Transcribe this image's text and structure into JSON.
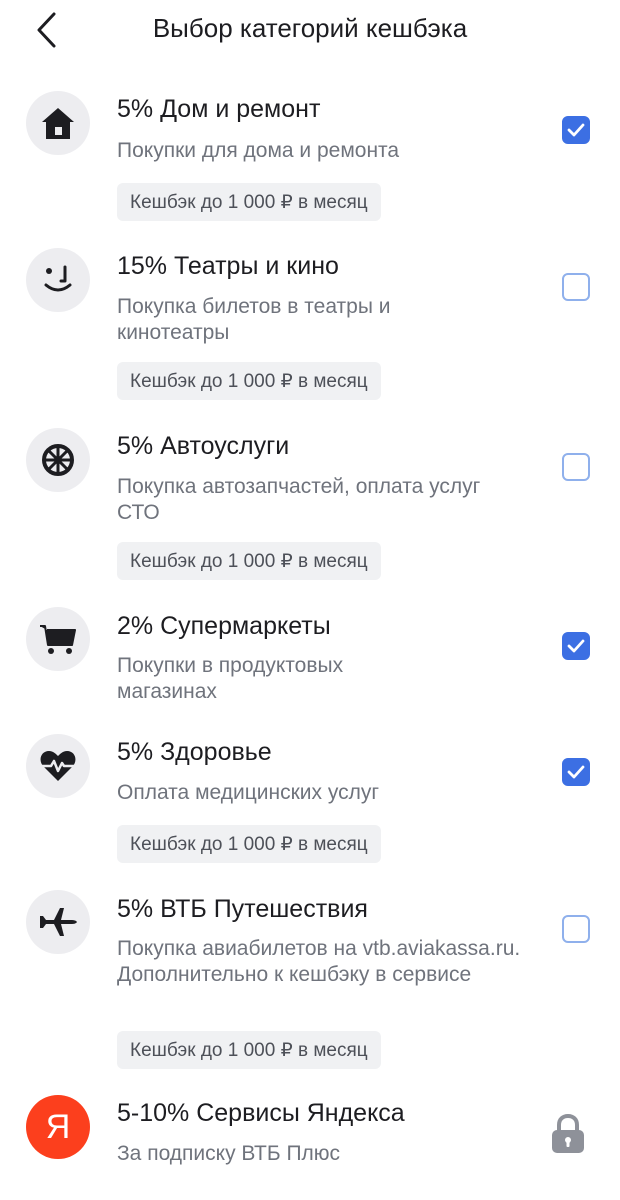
{
  "header": {
    "title": "Выбор категорий кешбэка"
  },
  "items": [
    {
      "title": "5% Дом и ремонт",
      "desc": "Покупки для дома и ремонта",
      "chip": "Кешбэк до 1 000 ₽ в месяц",
      "icon": "house-icon",
      "checked": true
    },
    {
      "title": "15% Театры и кино",
      "desc": "Покупка билетов в театры и кинотеатры",
      "chip": "Кешбэк до 1 000 ₽ в месяц",
      "icon": "smiley-icon",
      "checked": false
    },
    {
      "title": "5% Автоуслуги",
      "desc": "Покупка автозапчастей, оплата услуг СТО",
      "chip": "Кешбэк до 1 000 ₽ в месяц",
      "icon": "wheel-icon",
      "checked": false
    },
    {
      "title": "2% Супермаркеты",
      "desc": "Покупки в продуктовых магазинах",
      "icon": "cart-icon",
      "checked": true
    },
    {
      "title": "5% Здоровье",
      "desc": "Оплата медицинских услуг",
      "chip": "Кешбэк до 1 000 ₽ в месяц",
      "icon": "heart-pulse-icon",
      "checked": true
    },
    {
      "title": "5% ВТБ Путешествия",
      "desc": "Покупка авиабилетов на vtb.aviakassa.ru. Дополнительно к кешбэку в сервисе",
      "chip": "Кешбэк до 1 000 ₽ в месяц",
      "icon": "airplane-icon",
      "checked": false
    },
    {
      "title": "5-10% Сервисы Яндекса",
      "desc": "За подписку ВТБ Плюс",
      "icon": "yandex-icon",
      "locked": true,
      "logo_text": "Я"
    }
  ],
  "colors": {
    "accent": "#3c6fe3",
    "checkbox_border": "#8fb0ec",
    "yandex": "#fc3f1d"
  }
}
